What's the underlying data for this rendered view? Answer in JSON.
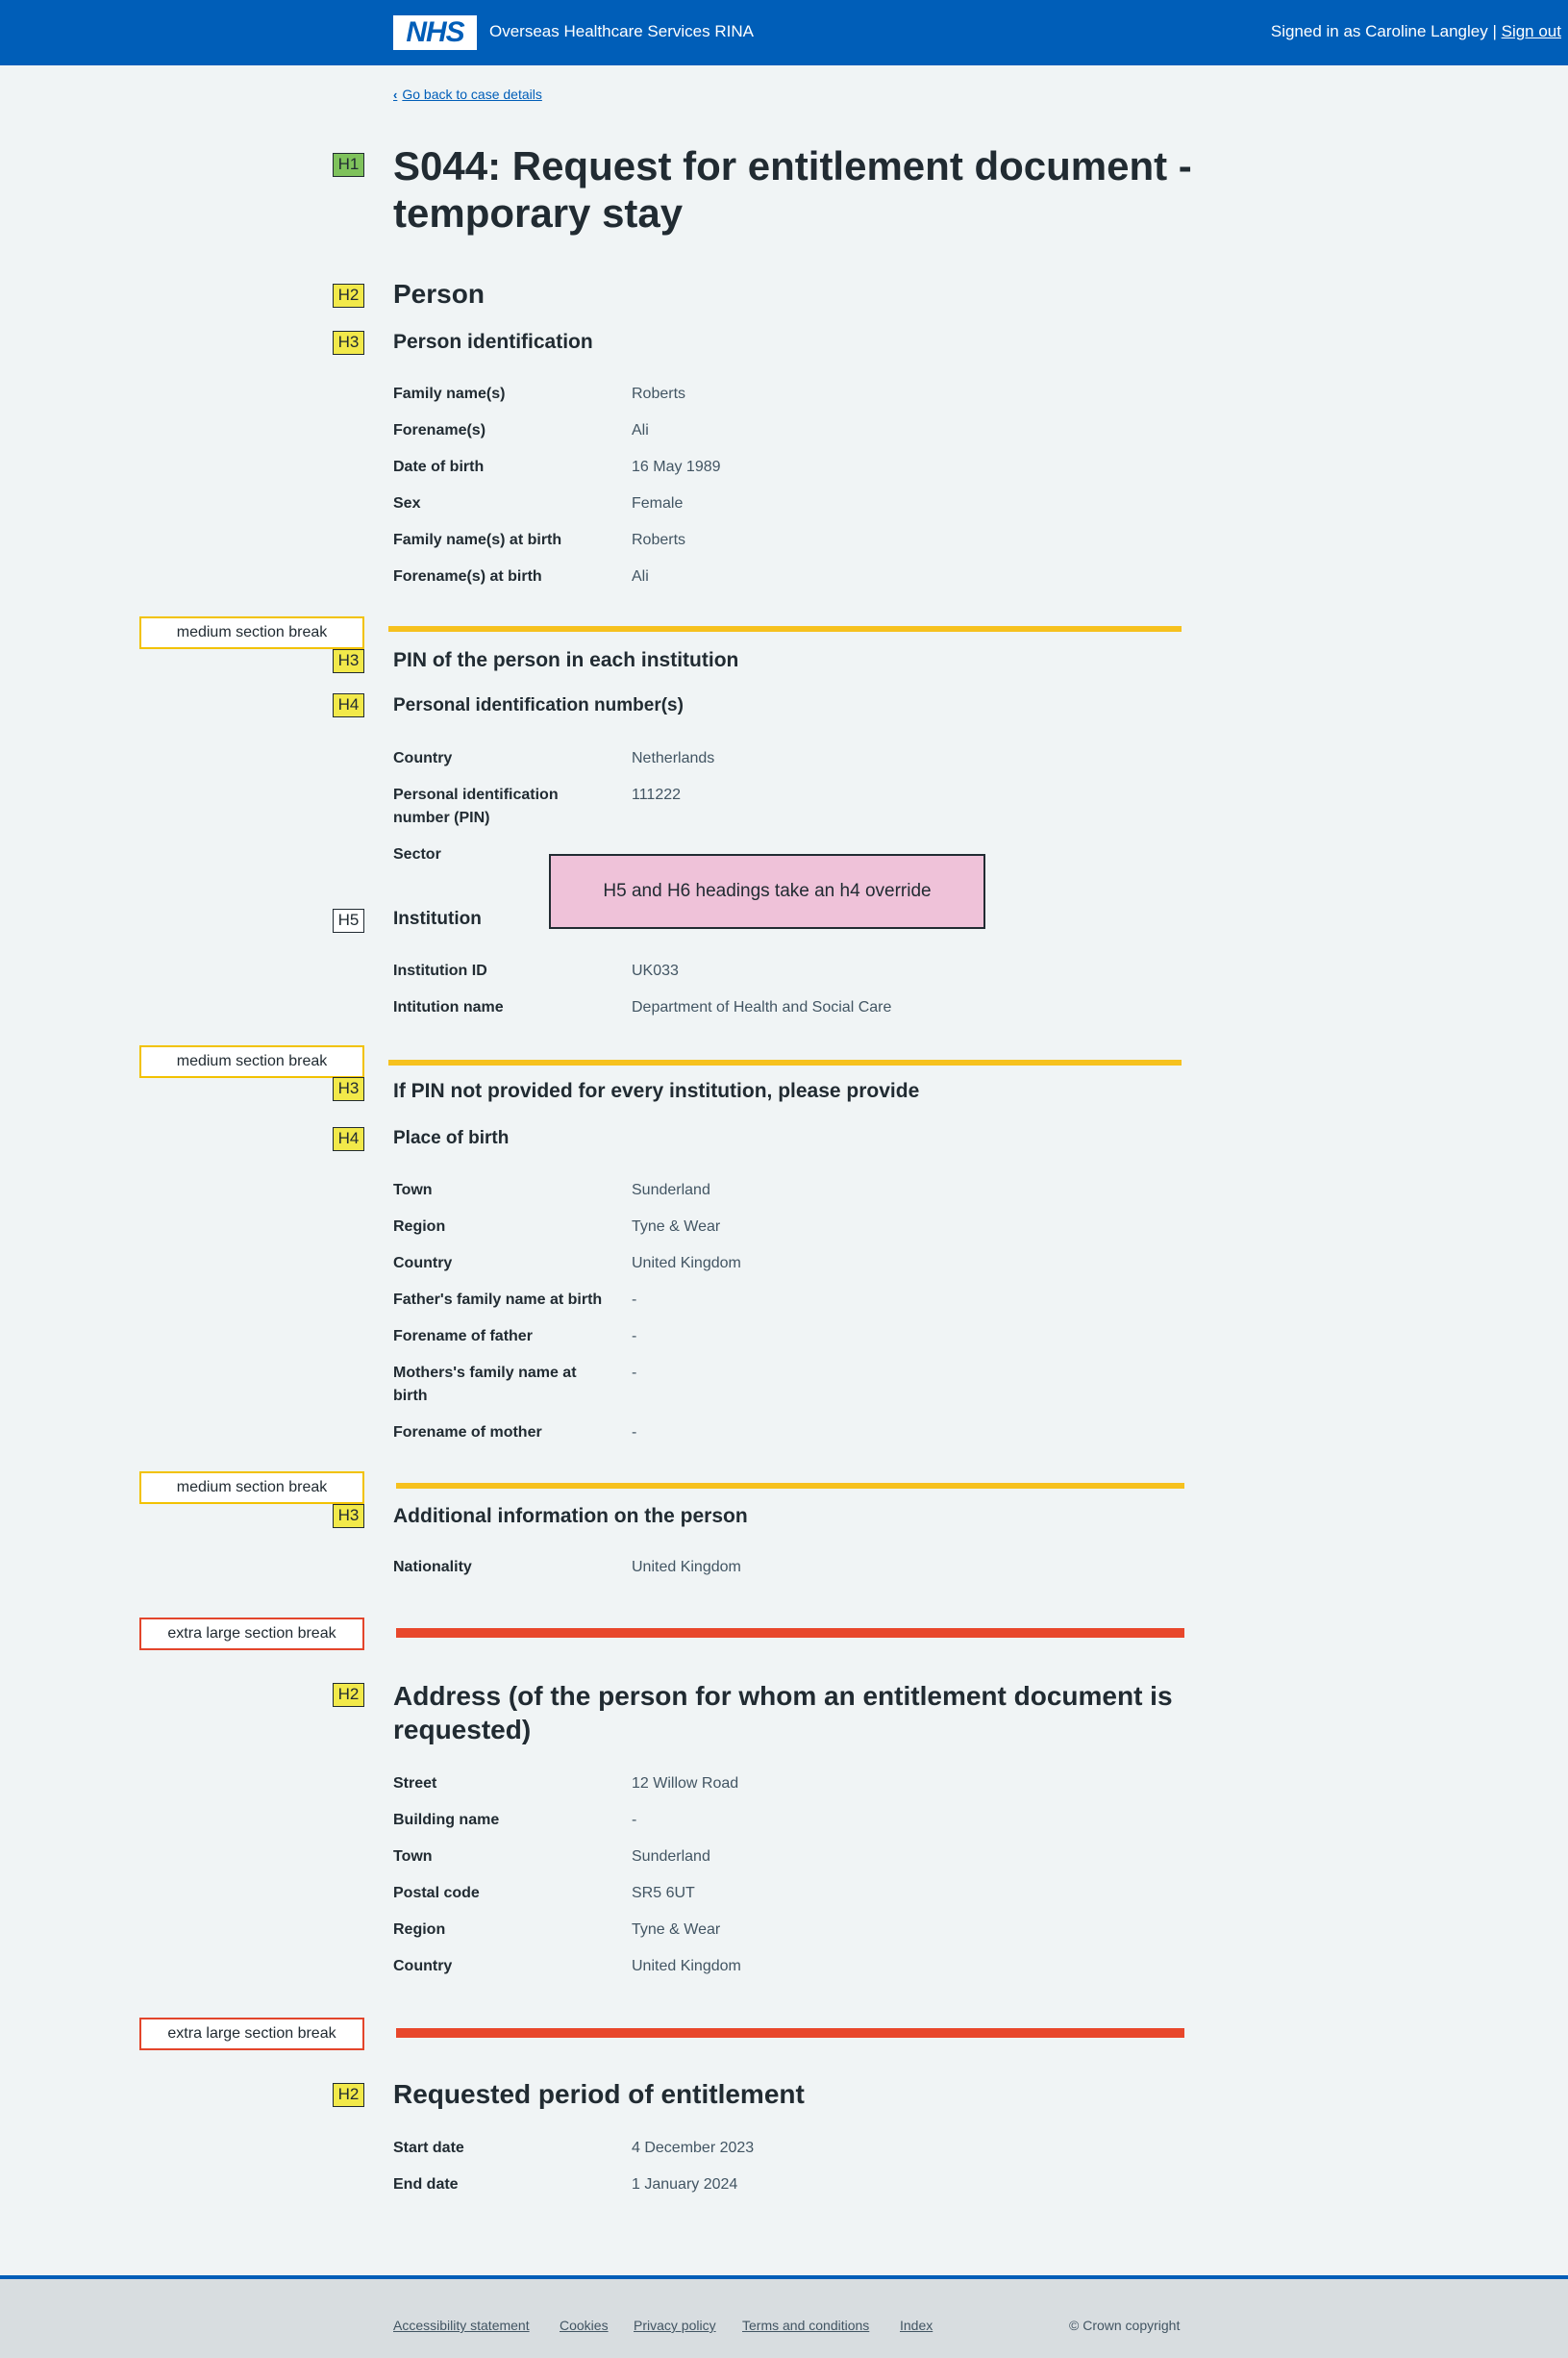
{
  "header": {
    "logo": "NHS",
    "service_name": "Overseas Healthcare Services RINA",
    "signed_in_prefix": "Signed in as Caroline Langley |",
    "sign_out": "Sign out"
  },
  "back_link": "Go back to case details",
  "title": "S044: Request for entitlement document - temporary stay",
  "tags": {
    "h1": "H1",
    "h2": "H2",
    "h3": "H3",
    "h4": "H4",
    "h5": "H5"
  },
  "breaks": {
    "medium": "medium section break",
    "extra_large": "extra large section break"
  },
  "override_note": "H5 and H6 headings take an h4 override",
  "person": {
    "heading": "Person",
    "identification": {
      "heading": "Person identification",
      "rows": [
        {
          "label": "Family name(s)",
          "value": "Roberts"
        },
        {
          "label": "Forename(s)",
          "value": "Ali"
        },
        {
          "label": "Date of birth",
          "value": "16 May 1989"
        },
        {
          "label": "Sex",
          "value": "Female"
        },
        {
          "label": "Family name(s) at birth",
          "value": "Roberts"
        },
        {
          "label": "Forename(s) at birth",
          "value": "Ali"
        }
      ]
    },
    "pin": {
      "heading": "PIN of the person in each institution",
      "subheading": "Personal identification number(s)",
      "rows": [
        {
          "label": "Country",
          "value": "Netherlands"
        },
        {
          "label": "Personal identification number (PIN)",
          "value": "111222"
        },
        {
          "label": "Sector",
          "value": "-"
        }
      ],
      "institution_heading": "Institution",
      "institution_rows": [
        {
          "label": "Institution ID",
          "value": "UK033"
        },
        {
          "label": "Intitution name",
          "value": "Department of Health and Social Care"
        }
      ]
    },
    "pin_missing": {
      "heading": "If PIN not provided for every institution, please provide",
      "subheading": "Place of birth",
      "rows": [
        {
          "label": "Town",
          "value": "Sunderland"
        },
        {
          "label": "Region",
          "value": "Tyne & Wear"
        },
        {
          "label": "Country",
          "value": "United Kingdom"
        },
        {
          "label": "Father's family name at birth",
          "value": "-"
        },
        {
          "label": "Forename of father",
          "value": "-"
        },
        {
          "label": "Mothers's family name at birth",
          "value": "-"
        },
        {
          "label": "Forename of mother",
          "value": "-"
        }
      ]
    },
    "additional": {
      "heading": "Additional information on the person",
      "rows": [
        {
          "label": "Nationality",
          "value": "United Kingdom"
        }
      ]
    }
  },
  "address": {
    "heading": "Address (of the person for whom an entitlement document is requested)",
    "rows": [
      {
        "label": "Street",
        "value": "12 Willow Road"
      },
      {
        "label": "Building name",
        "value": "-"
      },
      {
        "label": "Town",
        "value": "Sunderland"
      },
      {
        "label": "Postal code",
        "value": "SR5 6UT"
      },
      {
        "label": "Region",
        "value": "Tyne & Wear"
      },
      {
        "label": "Country",
        "value": "United Kingdom"
      }
    ]
  },
  "period": {
    "heading": "Requested period of entitlement",
    "rows": [
      {
        "label": "Start date",
        "value": "4 December 2023"
      },
      {
        "label": "End date",
        "value": "1 January 2024"
      }
    ]
  },
  "footer": {
    "links": [
      "Accessibility statement",
      "Cookies",
      "Privacy policy",
      "Terms and conditions",
      "Index"
    ],
    "copyright": "© Crown copyright"
  },
  "colors": {
    "header_blue": "#005eb8",
    "medium_break": "#f6c11e",
    "extra_large_break": "#e8472b",
    "h1_tag": "#7fc25c",
    "h2_h3_h4_tag": "#f2e94a",
    "override_note": "#efc2d9"
  }
}
